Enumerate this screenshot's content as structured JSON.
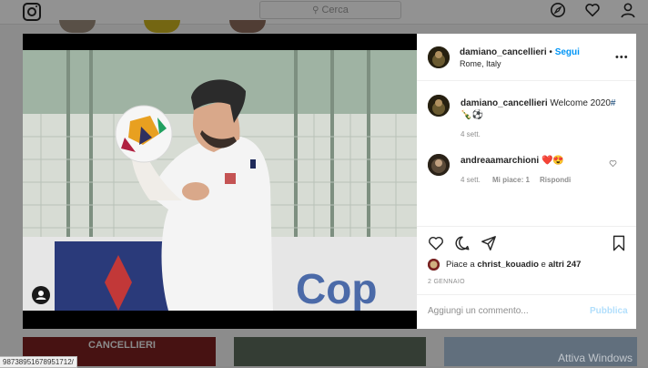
{
  "topbar": {
    "search_placeholder": "Cerca",
    "icons": [
      "instagram-logo-icon",
      "compass-icon",
      "heart-icon",
      "profile-icon"
    ]
  },
  "post": {
    "username": "damiano_cancellieri",
    "separator": "•",
    "follow_label": "Segui",
    "location": "Rome, Italy",
    "more_label": "•••",
    "caption_user": "damiano_cancellieri",
    "caption_text": "Welcome 2020",
    "caption_hash": "#",
    "caption_emoji": "🍾⚽",
    "caption_time": "4 sett.",
    "comment": {
      "user": "andreaamarchioni",
      "text": "❤️😍",
      "time": "4 sett.",
      "likes": "Mi piace: 1",
      "reply": "Rispondi"
    },
    "likes_prefix": "Piace a",
    "likes_user": "christ_kouadio",
    "likes_conj": "e",
    "likes_others": "altri 247",
    "date": "2 GENNAIO",
    "comment_placeholder": "Aggiungi un commento...",
    "publish_label": "Pubblica"
  },
  "photo": {
    "jersey_text": "CANCELLIERI",
    "board_text": "Cop"
  },
  "status_url": "98738951678951712/",
  "watermark": "Attiva Windows",
  "colors": {
    "accent": "#0095f6",
    "publish_disabled": "#b2dffc",
    "heart": "#ed4956"
  }
}
